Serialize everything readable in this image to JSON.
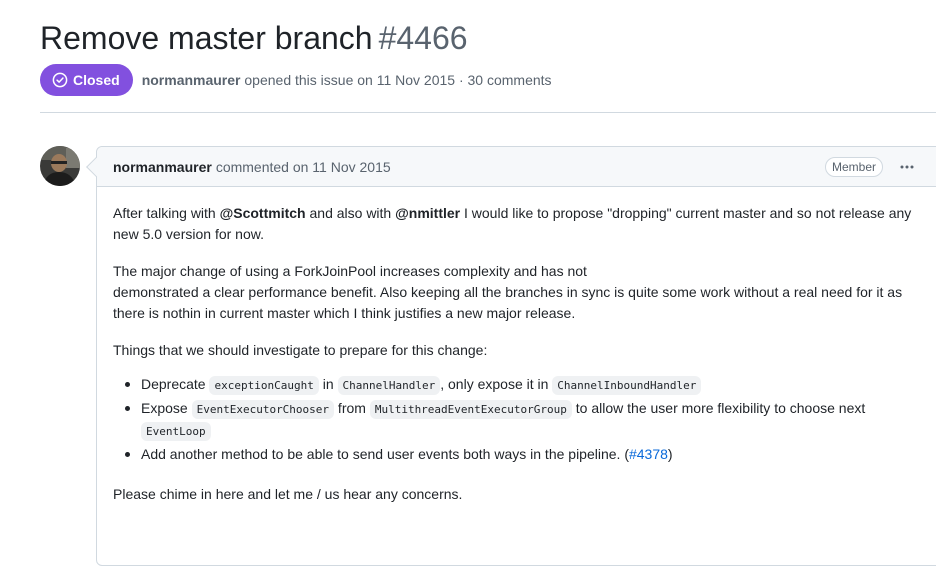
{
  "issue": {
    "title": "Remove master branch",
    "number": "#4466",
    "state": "Closed",
    "state_color": "#8250df",
    "author": "normanmaurer",
    "opened_text": "opened this issue on 11 Nov 2015 · 30 comments"
  },
  "comment": {
    "author": "normanmaurer",
    "meta": "commented on 11 Nov 2015",
    "role": "Member",
    "more_icon": "kebab-horizontal-icon",
    "p1": {
      "t1": "After talking with ",
      "m1": "@Scottmitch",
      "t2": " and also with ",
      "m2": "@nmittler",
      "t3": " I would like to propose \"dropping\" current master and so not release any new 5.0 version for now."
    },
    "p2": {
      "l1": "The major change of using a ForkJoinPool increases complexity and has not",
      "l2": "demonstrated a clear performance benefit. Also keeping all the branches in sync is quite some work without a real need for it as there is nothin in current master which I think justifies a new major release."
    },
    "p3": "Things that we should investigate to prepare for this change:",
    "items": [
      {
        "t1": "Deprecate ",
        "c1": "exceptionCaught",
        "t2": " in ",
        "c2": "ChannelHandler",
        "t3": ", only expose it in ",
        "c3": "ChannelInboundHandler"
      },
      {
        "t1": "Expose ",
        "c1": "EventExecutorChooser",
        "t2": " from ",
        "c2": "MultithreadEventExecutorGroup",
        "t3": " to allow the user more flexibility to choose next ",
        "c3": "EventLoop"
      },
      {
        "t1": "Add another method to be able to send user events both ways in the pipeline. (",
        "link": "#4378",
        "t2": ")"
      }
    ],
    "p4": "Please chime in here and let me / us hear any concerns."
  }
}
